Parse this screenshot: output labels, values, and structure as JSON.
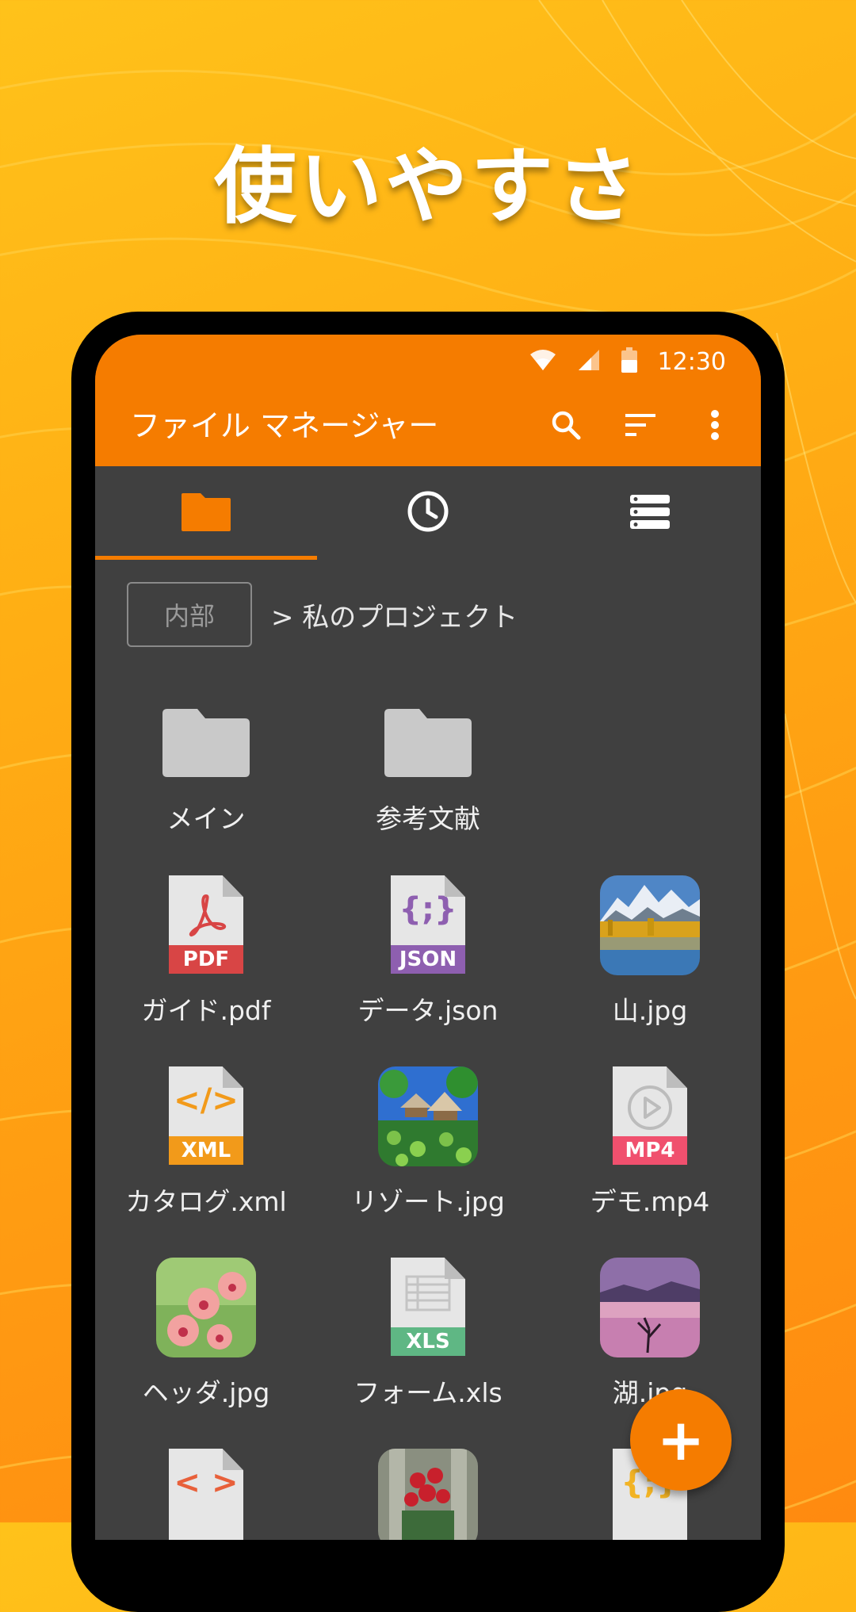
{
  "headline": "使いやすさ",
  "status_bar": {
    "time": "12:30"
  },
  "app_bar": {
    "title": "ファイル マネージャー",
    "actions": [
      "search-icon",
      "sort-icon",
      "more-vert-icon"
    ]
  },
  "tabs": [
    {
      "icon": "folder-icon",
      "active": true
    },
    {
      "icon": "clock-icon",
      "active": false
    },
    {
      "icon": "storage-icon",
      "active": false
    }
  ],
  "breadcrumb": {
    "root": "内部",
    "path": "> 私のプロジェクト"
  },
  "files": [
    {
      "name": "メイン",
      "kind": "folder"
    },
    {
      "name": "参考文献",
      "kind": "folder"
    },
    {
      "name": "ガイド.pdf",
      "kind": "doc",
      "badge": "PDF",
      "color": "#d84545"
    },
    {
      "name": "データ.json",
      "kind": "doc",
      "badge": "JSON",
      "color": "#8e5fb0"
    },
    {
      "name": "山.jpg",
      "kind": "photo"
    },
    {
      "name": "カタログ.xml",
      "kind": "doc",
      "badge": "XML",
      "color": "#f29a1a"
    },
    {
      "name": "リゾート.jpg",
      "kind": "photo"
    },
    {
      "name": "デモ.mp4",
      "kind": "doc",
      "badge": "MP4",
      "color": "#f0506e"
    },
    {
      "name": "ヘッダ.jpg",
      "kind": "photo"
    },
    {
      "name": "フォーム.xls",
      "kind": "doc",
      "badge": "XLS",
      "color": "#5fb784"
    },
    {
      "name": "湖.jpg",
      "kind": "photo"
    }
  ],
  "fab": {
    "label": "+"
  },
  "colors": {
    "accent": "#f57c00",
    "surface": "#404040"
  }
}
